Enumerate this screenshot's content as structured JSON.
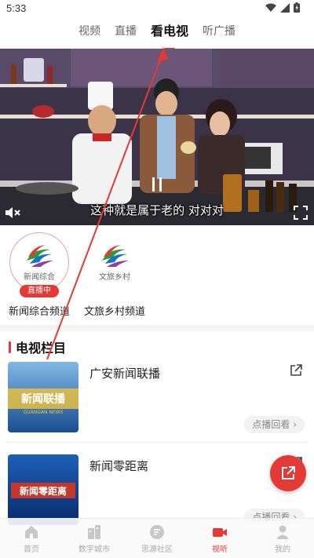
{
  "status_bar": {
    "time": "5:33"
  },
  "top_tabs": [
    {
      "label": "视频",
      "active": false
    },
    {
      "label": "直播",
      "active": false
    },
    {
      "label": "看电视",
      "active": true
    },
    {
      "label": "听广播",
      "active": false
    }
  ],
  "player": {
    "subtitle": "这种就是属于老的  对对对"
  },
  "channels": [
    {
      "name": "新闻综合频道",
      "logo_text": "新闻综合",
      "live_badge": "直播中"
    },
    {
      "name": "文旅乡村频道",
      "logo_text": "文旅乡村",
      "live_badge": ""
    }
  ],
  "section": {
    "title": "电视栏目"
  },
  "programs": [
    {
      "title": "广安新闻联播",
      "replay_label": "点播回看 ›",
      "thumb_text": "新闻联播",
      "thumb_sub": "GUANGAN NEWS"
    },
    {
      "title": "新闻零距离",
      "replay_label": "点播回看 ›",
      "thumb_text": "新闻零距离",
      "thumb_sub": ""
    }
  ],
  "bottom_nav": [
    {
      "label": "首页",
      "icon": "home-icon"
    },
    {
      "label": "数字城市",
      "icon": "city-icon"
    },
    {
      "label": "思源社区",
      "icon": "community-icon"
    },
    {
      "label": "视听",
      "icon": "video-icon",
      "active": true
    },
    {
      "label": "我的",
      "icon": "profile-icon"
    }
  ],
  "colors": {
    "accent": "#e53935",
    "inactive": "#aaaaaa"
  }
}
